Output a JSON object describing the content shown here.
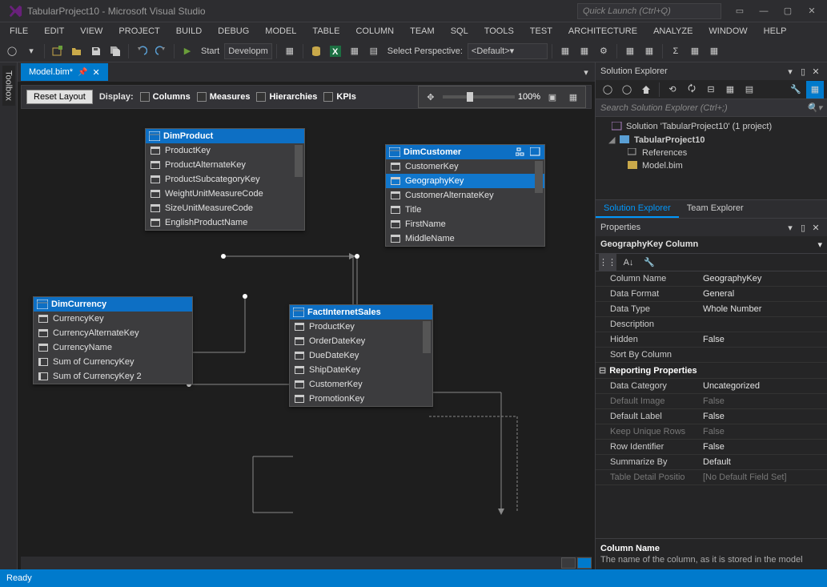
{
  "titlebar": {
    "title": "TabularProject10 - Microsoft Visual Studio",
    "quicklaunch_placeholder": "Quick Launch (Ctrl+Q)"
  },
  "menubar": [
    "FILE",
    "EDIT",
    "VIEW",
    "PROJECT",
    "BUILD",
    "DEBUG",
    "MODEL",
    "TABLE",
    "COLUMN",
    "TEAM",
    "SQL",
    "TOOLS",
    "TEST",
    "ARCHITECTURE",
    "ANALYZE",
    "WINDOW",
    "HELP"
  ],
  "toolbar": {
    "start": "Start",
    "config": "Developm",
    "perspective_label": "Select Perspective:",
    "perspective_value": "<Default>"
  },
  "doc_tab": {
    "name": "Model.bim*"
  },
  "designer_toolbar": {
    "reset": "Reset Layout",
    "display": "Display:",
    "columns": "Columns",
    "measures": "Measures",
    "hierarchies": "Hierarchies",
    "kpis": "KPIs",
    "zoom": "100%"
  },
  "tables": {
    "dimproduct": {
      "name": "DimProduct",
      "cols": [
        "ProductKey",
        "ProductAlternateKey",
        "ProductSubcategoryKey",
        "WeightUnitMeasureCode",
        "SizeUnitMeasureCode",
        "EnglishProductName"
      ]
    },
    "dimcustomer": {
      "name": "DimCustomer",
      "cols": [
        "CustomerKey",
        "GeographyKey",
        "CustomerAlternateKey",
        "Title",
        "FirstName",
        "MiddleName"
      ],
      "selected_index": 1
    },
    "dimcurrency": {
      "name": "DimCurrency",
      "cols": [
        "CurrencyKey",
        "CurrencyAlternateKey",
        "CurrencyName"
      ],
      "measures": [
        "Sum of CurrencyKey",
        "Sum of CurrencyKey 2"
      ]
    },
    "factinternetsales": {
      "name": "FactInternetSales",
      "cols": [
        "ProductKey",
        "OrderDateKey",
        "DueDateKey",
        "ShipDateKey",
        "CustomerKey",
        "PromotionKey"
      ]
    }
  },
  "solution_explorer": {
    "title": "Solution Explorer",
    "search_placeholder": "Search Solution Explorer (Ctrl+;)",
    "solution": "Solution 'TabularProject10' (1 project)",
    "project": "TabularProject10",
    "references": "References",
    "model": "Model.bim"
  },
  "panel_tabs": {
    "solution": "Solution Explorer",
    "team": "Team Explorer"
  },
  "properties": {
    "title": "Properties",
    "object": "GeographyKey Column",
    "rows": [
      {
        "name": "Column Name",
        "value": "GeographyKey"
      },
      {
        "name": "Data Format",
        "value": "General"
      },
      {
        "name": "Data Type",
        "value": "Whole Number"
      },
      {
        "name": "Description",
        "value": ""
      },
      {
        "name": "Hidden",
        "value": "False"
      },
      {
        "name": "Sort By Column",
        "value": ""
      }
    ],
    "reporting_cat": "Reporting Properties",
    "reporting_rows": [
      {
        "name": "Data Category",
        "value": "Uncategorized"
      },
      {
        "name": "Default Image",
        "value": "False",
        "muted": true
      },
      {
        "name": "Default Label",
        "value": "False"
      },
      {
        "name": "Keep Unique Rows",
        "value": "False",
        "muted": true
      },
      {
        "name": "Row Identifier",
        "value": "False"
      },
      {
        "name": "Summarize By",
        "value": "Default"
      },
      {
        "name": "Table Detail Positio",
        "value": "[No Default Field Set]",
        "muted": true
      }
    ],
    "desc_name": "Column Name",
    "desc_text": "The name of the column, as it is stored in the model"
  },
  "statusbar": {
    "ready": "Ready"
  },
  "sidetab": {
    "toolbox": "Toolbox"
  }
}
